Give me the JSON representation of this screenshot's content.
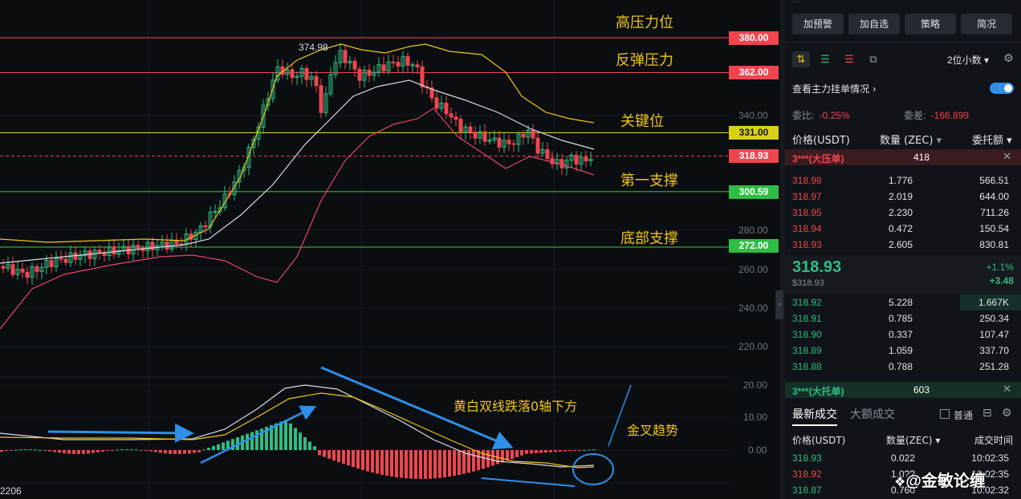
{
  "chart": {
    "price_labels": {
      "high_resist": "380.00",
      "rebound_resist": "362.00",
      "key_level": "331.00",
      "current": "318.93",
      "first_support": "300.59",
      "bottom_support": "272.00"
    },
    "axis_ticks": [
      "340.00",
      "280.00",
      "260.00",
      "240.00",
      "220.00",
      "20.00",
      "10.00",
      "0.00"
    ],
    "peak_label": "374.98",
    "bottom_left_label": "2206",
    "annotations": {
      "high_resist": "高压力位",
      "rebound_resist": "反弹压力",
      "key_level": "关键位",
      "first_support": "第一支撑",
      "bottom_support": "底部支撑",
      "macd_note": "黄白双线跌落0轴下方",
      "golden_cross": "金叉趋势"
    },
    "colors": {
      "up": "#2ebd85",
      "down": "#f0454f",
      "yellow_line": "#f0c419",
      "arrow_blue": "#2e8fe8"
    }
  },
  "panel": {
    "top_buttons": [
      "加预警",
      "加自选",
      "策略",
      "简况"
    ],
    "decimals": "2位小数",
    "depth_toggle_label": "查看主力挂单情况",
    "ratio_label": "委比:",
    "ratio_value": "-0.25%",
    "diff_label": "委差:",
    "diff_value": "-166.899",
    "col_price": "价格(USDT)",
    "col_qty": "数量 (ZEC)",
    "col_total": "委托额",
    "big_ask_tag": "3***(大压单)",
    "big_ask_qty": "418",
    "asks": [
      {
        "price": "318.98",
        "qty": "1.776",
        "total": "566.51"
      },
      {
        "price": "318.97",
        "qty": "2.019",
        "total": "644.00"
      },
      {
        "price": "318.95",
        "qty": "2.230",
        "total": "711.26"
      },
      {
        "price": "318.94",
        "qty": "0.472",
        "total": "150.54"
      },
      {
        "price": "318.93",
        "qty": "2.605",
        "total": "830.81"
      }
    ],
    "last_price": "318.93",
    "last_price_sub": "$318.93",
    "change_pct": "+1.1%",
    "change_abs": "+3.48",
    "bids": [
      {
        "price": "318.92",
        "qty": "5.228",
        "total": "1.667K"
      },
      {
        "price": "318.91",
        "qty": "0.785",
        "total": "250.34"
      },
      {
        "price": "318.90",
        "qty": "0.337",
        "total": "107.47"
      },
      {
        "price": "318.89",
        "qty": "1.059",
        "total": "337.70"
      },
      {
        "price": "318.88",
        "qty": "0.788",
        "total": "251.28"
      }
    ],
    "big_bid_tag": "3***(大托单)",
    "big_bid_qty": "603",
    "trades_tab": "最新成交",
    "big_trades_tab": "大额成交",
    "normal_label": "普通",
    "trade_col_price": "价格(USDT)",
    "trade_col_qty": "数量(ZEC)",
    "trade_col_time": "成交时间",
    "trades": [
      {
        "price": "318.93",
        "qty": "0.022",
        "time": "10:02:35"
      },
      {
        "price": "318.92",
        "qty": "1.0??",
        "time": "10:02:35"
      },
      {
        "price": "318.87",
        "qty": "0.760",
        "time": "10:02:32"
      }
    ],
    "watermark": "@金敏论缠"
  }
}
